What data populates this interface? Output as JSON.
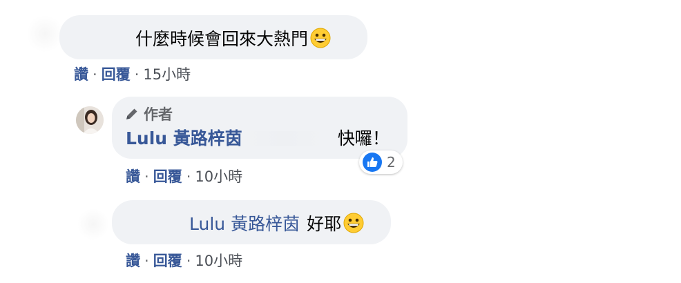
{
  "comments": [
    {
      "text": "什麼時候會回來大熱門",
      "actions": {
        "like": "讚",
        "reply": "回覆",
        "time": "15小時"
      }
    },
    {
      "badge": "作者",
      "author": "Lulu 黃路梓茵",
      "text": "快囉！",
      "reaction_count": "2",
      "actions": {
        "like": "讚",
        "reply": "回覆",
        "time": "10小時"
      }
    },
    {
      "mention": "Lulu 黃路梓茵",
      "text": "好耶",
      "actions": {
        "like": "讚",
        "reply": "回覆",
        "time": "10小時"
      }
    }
  ],
  "separator": "·",
  "colors": {
    "link": "#385898",
    "bubble": "#f0f2f5",
    "like_blue": "#1877f2"
  },
  "icons": [
    "grinning-emoji-icon",
    "pencil-icon",
    "like-thumb-icon"
  ]
}
